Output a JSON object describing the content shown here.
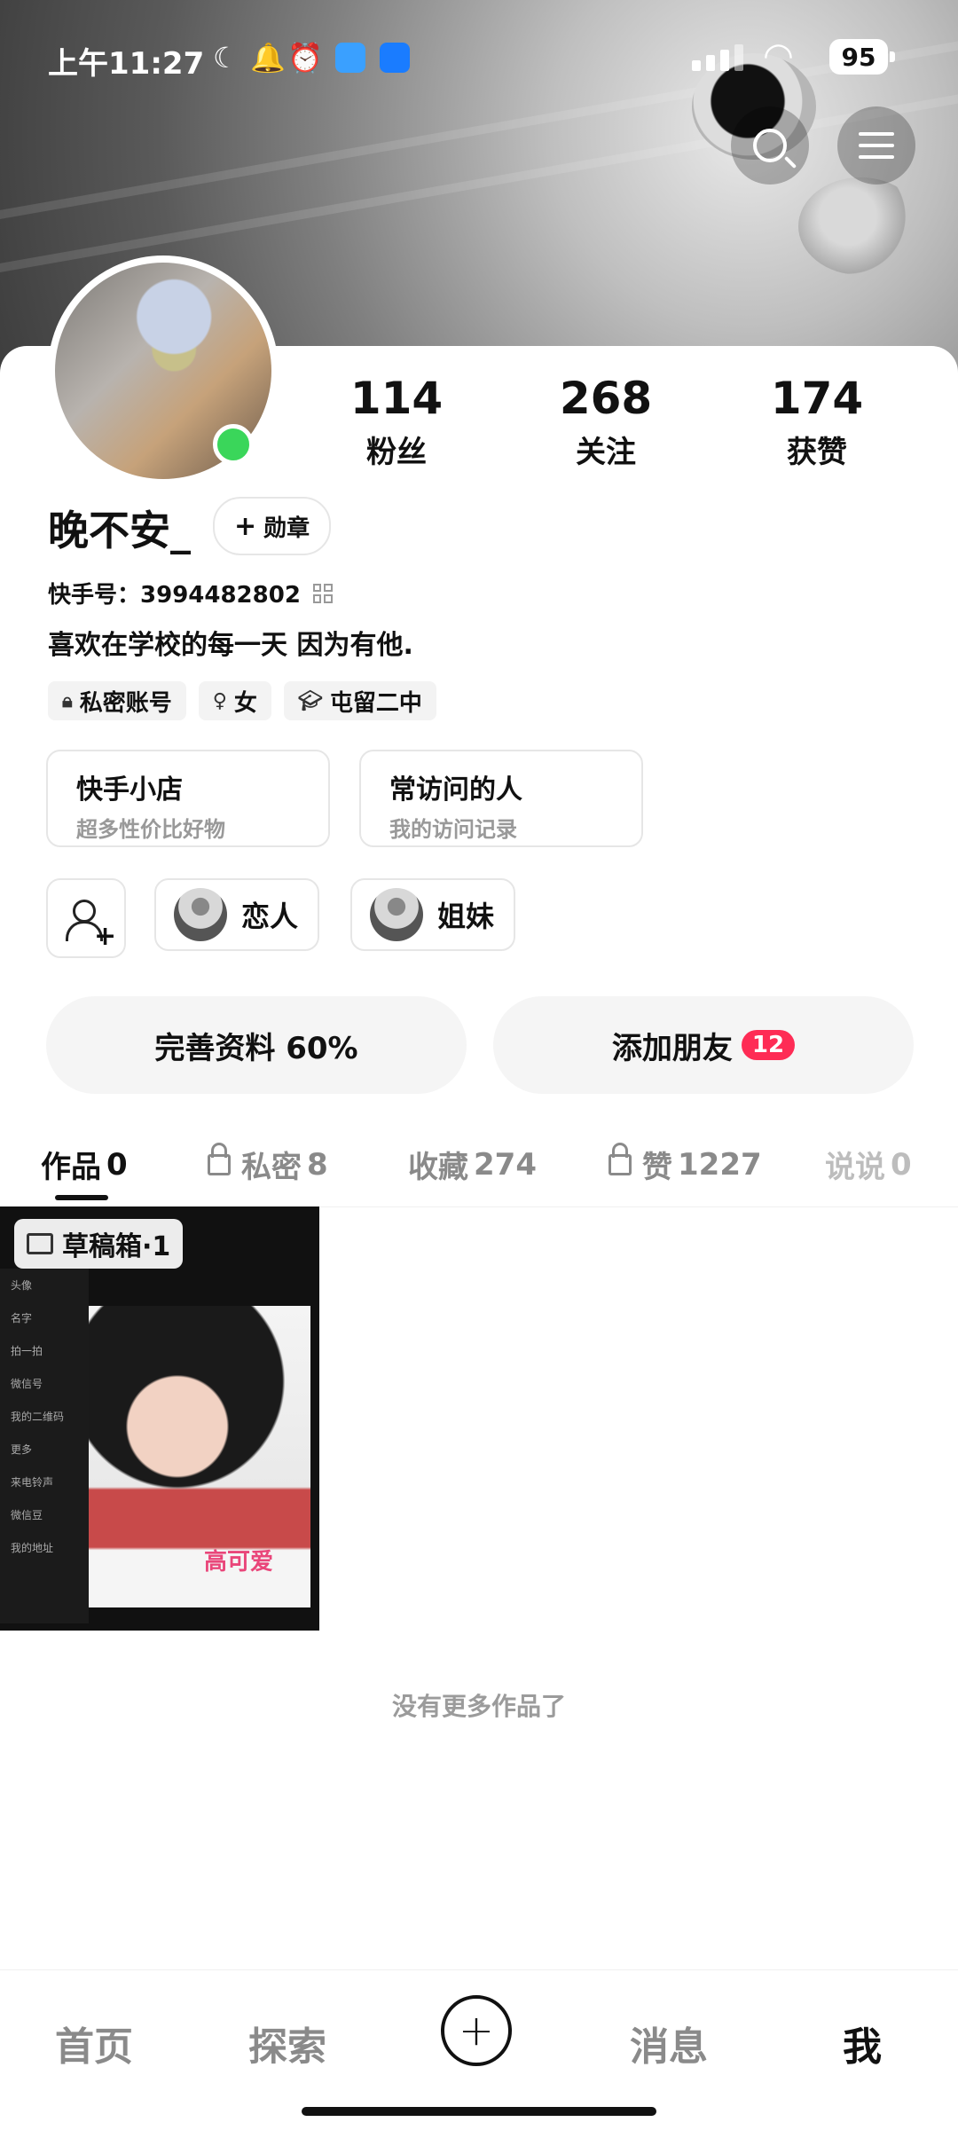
{
  "status_bar": {
    "time": "上午11:27",
    "battery": "95"
  },
  "profile": {
    "name": "晚不安_",
    "badge_button": "勋章",
    "kuaishou_label": "快手号：",
    "kuaishou_id": "3994482802",
    "bio": "喜欢在学校的每一天 因为有他.",
    "tags": [
      "私密账号",
      "女",
      "屯留二中"
    ],
    "online": true
  },
  "stats": [
    {
      "value": "114",
      "label": "粉丝"
    },
    {
      "value": "268",
      "label": "关注"
    },
    {
      "value": "174",
      "label": "获赞"
    }
  ],
  "cards": [
    {
      "title": "快手小店",
      "subtitle": "超多性价比好物"
    },
    {
      "title": "常访问的人",
      "subtitle": "我的访问记录"
    }
  ],
  "relations": [
    "恋人",
    "姐妹"
  ],
  "actions": {
    "complete_profile": "完善资料 60%",
    "add_friends": "添加朋友",
    "add_friends_count": "12"
  },
  "tabs": [
    {
      "label": "作品",
      "count": "0"
    },
    {
      "label": "私密",
      "count": "8"
    },
    {
      "label": "收藏",
      "count": "274"
    },
    {
      "label": "赞",
      "count": "1227"
    },
    {
      "label": "说说",
      "count": "0"
    }
  ],
  "drafts_label": "草稿箱·1",
  "thumb_menu": [
    "头像",
    "名字",
    "拍一拍",
    "微信号",
    "我的二维码",
    "更多",
    "来电铃声",
    "微信豆",
    "我的地址"
  ],
  "thumb_sticker": "高可爱",
  "no_more": "没有更多作品了",
  "bottom_nav": [
    "首页",
    "探索",
    "消息",
    "我"
  ]
}
